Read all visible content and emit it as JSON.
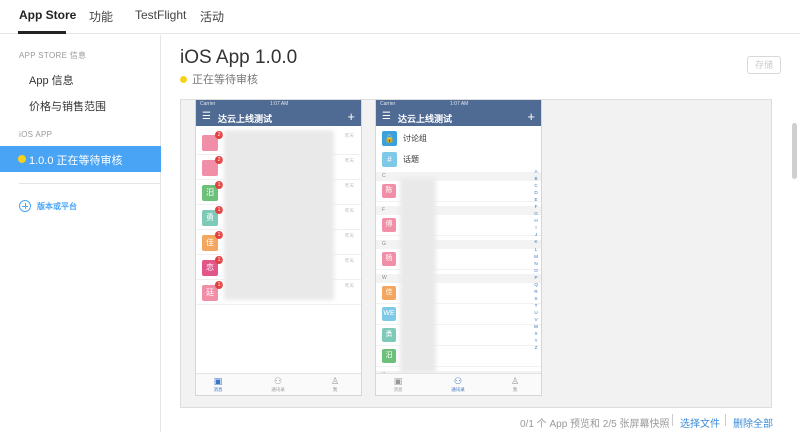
{
  "tabs": [
    {
      "label": "App Store",
      "active": true
    },
    {
      "label": "功能",
      "active": false
    },
    {
      "label": "TestFlight",
      "active": false
    },
    {
      "label": "活动",
      "active": false
    }
  ],
  "sidebar": {
    "section_store": "APP STORE 信息",
    "items": [
      {
        "label": "App 信息"
      },
      {
        "label": "价格与销售范围"
      }
    ],
    "section_ios": "iOS APP",
    "active_version": "1.0.0 正在等待审核",
    "add_platform": "版本或平台"
  },
  "main": {
    "title": "iOS App 1.0.0",
    "status": "正在等待审核",
    "save_label": "存储",
    "footer_info": "0/1 个 App 预览和 2/5 张屏幕快照",
    "choose_file": "选择文件",
    "delete_all": "删除全部"
  },
  "phone_left": {
    "carrier": "Carrier ",
    "clock": "1:07 AM",
    "title": "达云上线测试",
    "rows": [
      {
        "avatar": "",
        "badge": "2",
        "color": "#f08fa7",
        "time": "昨天"
      },
      {
        "avatar": "",
        "badge": "2",
        "color": "#f08fa7",
        "time": "昨天"
      },
      {
        "avatar": "汨",
        "badge": "1",
        "color": "#6cc07a",
        "time": "昨天"
      },
      {
        "avatar": "勇",
        "badge": "1",
        "color": "#7fc9b9",
        "time": "昨天"
      },
      {
        "avatar": "佳",
        "badge": "1",
        "color": "#f4a55e",
        "time": "昨天"
      },
      {
        "avatar": "恋",
        "badge": "1",
        "color": "#e2578a",
        "time": "昨天"
      },
      {
        "avatar": "廷",
        "badge": "1",
        "color": "#f08fa7",
        "time": "昨天"
      }
    ],
    "tabbar": [
      {
        "label": "消息",
        "icon": "chat-icon",
        "glyph": "▣",
        "active": true
      },
      {
        "label": "通讯录",
        "icon": "contacts-icon",
        "glyph": "⚇",
        "active": false
      },
      {
        "label": "我",
        "icon": "person-icon",
        "glyph": "♙",
        "active": false
      }
    ]
  },
  "phone_right": {
    "carrier": "Carrier ",
    "clock": "1:07 AM",
    "title": "达云上线测试",
    "groups": [
      {
        "label": "讨论组",
        "icon": "lock-icon",
        "glyph": "🔒",
        "color": "#3aa1dc"
      },
      {
        "label": "话题",
        "icon": "hash-icon",
        "glyph": "#",
        "color": "#7fc9e8"
      }
    ],
    "sections": [
      {
        "letter": "C",
        "contacts": [
          {
            "avatar": "陈",
            "color": "#f08fa7"
          }
        ]
      },
      {
        "letter": "F",
        "contacts": [
          {
            "avatar": "傅",
            "color": "#f08fa7"
          }
        ]
      },
      {
        "letter": "G",
        "contacts": [
          {
            "avatar": "杨",
            "color": "#f08fa7"
          }
        ]
      },
      {
        "letter": "W",
        "contacts": [
          {
            "avatar": "佳",
            "color": "#f4a55e"
          },
          {
            "avatar": "WE",
            "color": "#7fc9e8"
          },
          {
            "avatar": "勇",
            "color": "#7fc9b9"
          },
          {
            "avatar": "汨",
            "color": "#6cc07a"
          }
        ]
      },
      {
        "letter": "X",
        "contacts": [
          {
            "avatar": "",
            "color": "#6cc07a"
          }
        ]
      }
    ],
    "index": [
      "A",
      "B",
      "C",
      "D",
      "E",
      "F",
      "G",
      "H",
      "I",
      "J",
      "K",
      "L",
      "M",
      "N",
      "O",
      "P",
      "Q",
      "R",
      "S",
      "T",
      "U",
      "V",
      "W",
      "X",
      "Y",
      "Z"
    ],
    "tabbar": [
      {
        "label": "消息",
        "icon": "chat-icon",
        "glyph": "▣",
        "active": false
      },
      {
        "label": "通讯录",
        "icon": "contacts-icon",
        "glyph": "⚇",
        "active": true
      },
      {
        "label": "我",
        "icon": "person-icon",
        "glyph": "♙",
        "active": false
      }
    ]
  },
  "colors": {
    "accent": "#4aa4f6",
    "status_dot": "#f6d21f",
    "link": "#3a8bd8",
    "phone_nav": "#4f6a93"
  }
}
